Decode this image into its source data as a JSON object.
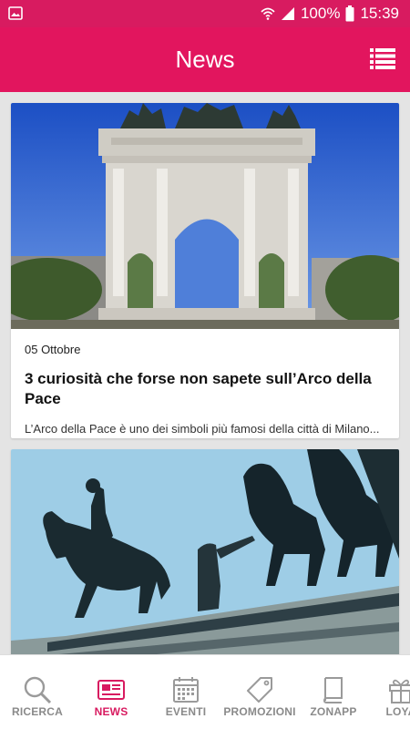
{
  "status_bar": {
    "battery": "100%",
    "time": "15:39",
    "icons": [
      "image-icon",
      "wifi-icon",
      "signal-icon",
      "battery-icon"
    ]
  },
  "app_bar": {
    "title": "News",
    "menu_icon": "list-icon"
  },
  "colors": {
    "accent": "#e2155e",
    "status_bar": "#d81b60",
    "inactive_nav": "#8a8a8a"
  },
  "articles": [
    {
      "date": "05 Ottobre",
      "title": "3 curiosità che forse non sapete sull’Arco della Pace",
      "excerpt": "L’Arco della Pace è uno dei simboli più famosi della città di Milano..."
    },
    {
      "date": "",
      "title": "",
      "excerpt": ""
    }
  ],
  "bottom_nav": [
    {
      "label": "RICERCA",
      "icon": "search-icon",
      "active": false
    },
    {
      "label": "NEWS",
      "icon": "news-icon",
      "active": true
    },
    {
      "label": "EVENTI",
      "icon": "calendar-icon",
      "active": false
    },
    {
      "label": "PROMOZIONI",
      "icon": "tag-icon",
      "active": false
    },
    {
      "label": "ZONAPP",
      "icon": "book-icon",
      "active": false
    },
    {
      "label": "LOYA",
      "icon": "gift-icon",
      "active": false
    }
  ]
}
